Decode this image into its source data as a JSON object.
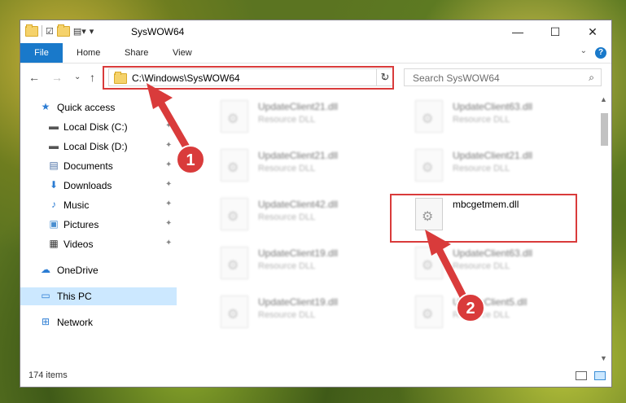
{
  "window": {
    "title": "SysWOW64",
    "minimize": "—",
    "maximize": "☐",
    "close": "✕"
  },
  "ribbon": {
    "file": "File",
    "home": "Home",
    "share": "Share",
    "view": "View",
    "expand": "⌄",
    "help": "?"
  },
  "nav": {
    "back": "←",
    "forward": "→",
    "recent": "⌄",
    "up": "↑",
    "address": "C:\\Windows\\SysWOW64",
    "address_dropdown": "⌄",
    "refresh": "↻",
    "search_placeholder": "Search SysWOW64",
    "search_icon": "⌕"
  },
  "sidebar": {
    "items": [
      {
        "label": "Quick access",
        "icon": "star-icon",
        "glyph": "★",
        "color": "#2b7cd3",
        "pinned": false
      },
      {
        "label": "Local Disk (C:)",
        "icon": "drive-icon",
        "glyph": "▬",
        "color": "#555555",
        "pinned": true
      },
      {
        "label": "Local Disk (D:)",
        "icon": "drive-icon",
        "glyph": "▬",
        "color": "#555555",
        "pinned": true
      },
      {
        "label": "Documents",
        "icon": "document-icon",
        "glyph": "▤",
        "color": "#4a6fa5",
        "pinned": true
      },
      {
        "label": "Downloads",
        "icon": "download-icon",
        "glyph": "⬇",
        "color": "#2b7cd3",
        "pinned": true
      },
      {
        "label": "Music",
        "icon": "music-icon",
        "glyph": "♪",
        "color": "#2b7cd3",
        "pinned": true
      },
      {
        "label": "Pictures",
        "icon": "picture-icon",
        "glyph": "▣",
        "color": "#4a8fd0",
        "pinned": true
      },
      {
        "label": "Videos",
        "icon": "video-icon",
        "glyph": "▦",
        "color": "#333333",
        "pinned": true
      },
      {
        "label": "OneDrive",
        "icon": "cloud-icon",
        "glyph": "☁",
        "color": "#2b7cd3",
        "pinned": false
      },
      {
        "label": "This PC",
        "icon": "computer-icon",
        "glyph": "▭",
        "color": "#2b7cd3",
        "pinned": false
      },
      {
        "label": "Network",
        "icon": "network-icon",
        "glyph": "⊞",
        "color": "#2b7cd3",
        "pinned": false
      }
    ],
    "pin_glyph": "✦"
  },
  "files": [
    {
      "name": "UpdateClient21.dll",
      "type": "Resource DLL",
      "blurred": true
    },
    {
      "name": "UpdateClient63.dll",
      "type": "Resource DLL",
      "blurred": true
    },
    {
      "name": "UpdateClient21.dll",
      "type": "Resource DLL",
      "blurred": true
    },
    {
      "name": "UpdateClient21.dll",
      "type": "Resource DLL",
      "blurred": true
    },
    {
      "name": "UpdateClient42.dll",
      "type": "Resource DLL",
      "blurred": true
    },
    {
      "name": "mbcgetmem.dll",
      "type": "",
      "blurred": false
    },
    {
      "name": "UpdateClient19.dll",
      "type": "Resource DLL",
      "blurred": true
    },
    {
      "name": "UpdateClient63.dll",
      "type": "Resource DLL",
      "blurred": true
    },
    {
      "name": "UpdateClient19.dll",
      "type": "Resource DLL",
      "blurred": true
    },
    {
      "name": "UpdateClient5.dll",
      "type": "Resource DLL",
      "blurred": true
    }
  ],
  "status": {
    "item_count": "174 items"
  },
  "annotations": {
    "step1": "1",
    "step2": "2",
    "color": "#d93b3b"
  }
}
